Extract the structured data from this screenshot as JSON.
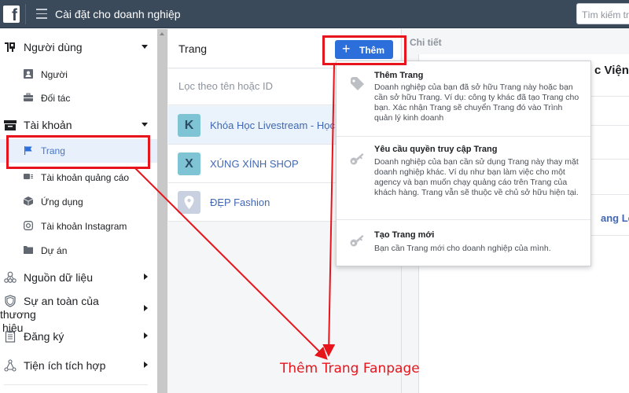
{
  "topbar": {
    "logo": "f",
    "title": "Cài đặt cho doanh nghiệp",
    "search_placeholder": "Tìm kiếm trong"
  },
  "sidebar": {
    "groups": [
      {
        "label": "Người dùng",
        "icon": "users-icon",
        "expanded": true,
        "items": [
          {
            "label": "Người",
            "icon": "person-icon"
          },
          {
            "label": "Đối tác",
            "icon": "briefcase-icon"
          }
        ]
      },
      {
        "label": "Tài khoản",
        "icon": "archive-icon",
        "expanded": true,
        "items": [
          {
            "label": "Trang",
            "icon": "flag-icon",
            "active": true
          },
          {
            "label": "Tài khoản quảng cáo",
            "icon": "ad-account-icon"
          },
          {
            "label": "Ứng dụng",
            "icon": "cube-icon"
          },
          {
            "label": "Tài khoản Instagram",
            "icon": "instagram-icon"
          },
          {
            "label": "Dự án",
            "icon": "folder-icon"
          }
        ]
      },
      {
        "label": "Nguồn dữ liệu",
        "icon": "data-sources-icon",
        "expanded": false
      },
      {
        "label": "Sự an toàn của thương hiệu",
        "icon": "shield-icon",
        "expanded": false
      },
      {
        "label": "Đăng ký",
        "icon": "clipboard-icon",
        "expanded": false
      },
      {
        "label": "Tiện ích tích hợp",
        "icon": "integrations-icon",
        "expanded": false
      }
    ]
  },
  "pages_panel": {
    "title": "Trang",
    "add_button": "Thêm",
    "filter_placeholder": "Lọc theo tên hoặc ID",
    "pages": [
      {
        "initial": "K",
        "name": "Khóa Học Livestream - Học Viện",
        "selected": true
      },
      {
        "initial": "X",
        "name": "XÚNG XÍNH SHOP",
        "selected": false
      },
      {
        "initial": "",
        "name": "ĐẸP Fashion",
        "selected": false,
        "avatar": "place-icon"
      }
    ]
  },
  "details_panel": {
    "label": "Chi tiết",
    "title_fragment": "c Viện",
    "link_fragment": "ang Lê"
  },
  "add_menu": {
    "items": [
      {
        "icon": "tag-icon",
        "title": "Thêm Trang",
        "description": "Doanh nghiệp của bạn đã sở hữu Trang này hoặc bạn cần sở hữu Trang. Ví dụ: công ty khác đã tạo Trang cho bạn. Xác nhận Trang sẽ chuyển Trang đó vào Trình quản lý kinh doanh"
      },
      {
        "icon": "key-icon",
        "title": "Yêu cầu quyền truy cập Trang",
        "description": "Doanh nghiệp của bạn cần sử dụng Trang này thay mặt doanh nghiệp khác. Ví dụ như bạn làm việc cho một agency và bạn muốn chạy quảng cáo trên Trang của khách hàng. Trang vẫn sẽ thuộc về chủ sở hữu hiện tại."
      },
      {
        "icon": "key-icon",
        "title": "Tạo Trang mới",
        "description": "Bạn cần Trang mới cho doanh nghiệp của mình."
      }
    ]
  },
  "annotation": {
    "text": "Thêm Trang Fanpage",
    "color": "#e8141c"
  },
  "colors": {
    "topbar": "#3b4a5b",
    "primary_button": "#2c6fdb",
    "link": "#4167b2",
    "active_item_bg": "#e7f0fb"
  }
}
